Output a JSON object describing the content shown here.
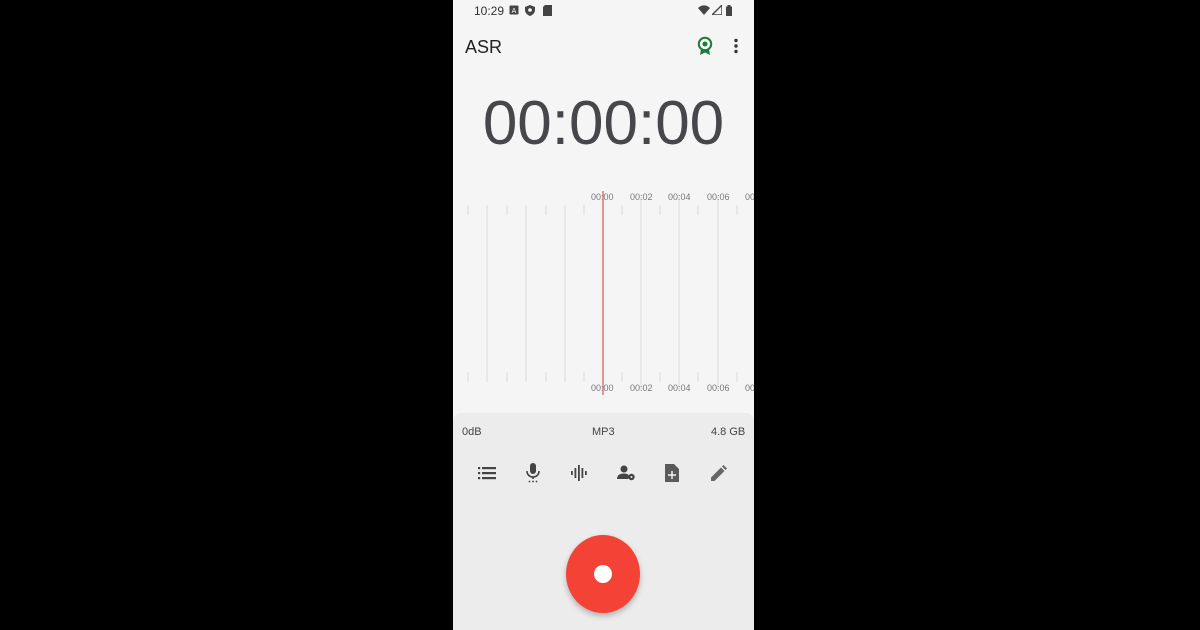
{
  "status_bar": {
    "time": "10:29",
    "left_icons": [
      "a-box-icon",
      "shield-icon",
      "sd-card-icon"
    ],
    "right_icons": [
      "wifi-icon",
      "signal-icon",
      "battery-icon"
    ]
  },
  "app_bar": {
    "title": "ASR",
    "actions": [
      "award-icon",
      "more-vert-icon"
    ]
  },
  "timer": "00:00:00",
  "waveform": {
    "top_ticks": [
      "00:00",
      "00:02",
      "00:04",
      "00:06",
      "00"
    ],
    "bottom_ticks": [
      "00:00",
      "00:02",
      "00:04",
      "00:06",
      "00"
    ],
    "playhead_color": "#e57373"
  },
  "recording_info": {
    "level": "0dB",
    "format": "MP3",
    "storage": "4.8 GB"
  },
  "toolbar": {
    "items": [
      "list-icon",
      "mic-icon",
      "waveform-icon",
      "person-settings-icon",
      "add-file-icon",
      "edit-icon"
    ]
  },
  "record_button": {
    "color": "#f44336"
  }
}
